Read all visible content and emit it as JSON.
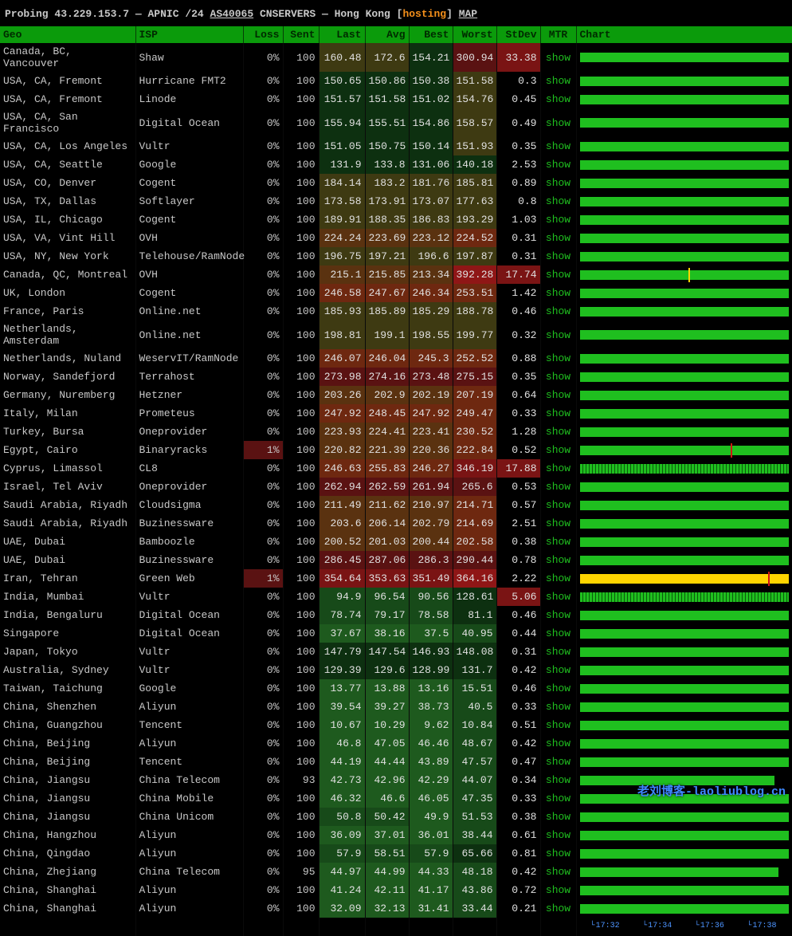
{
  "header": {
    "probing_label": "Probing",
    "ip": "43.229.153.7",
    "dash": "—",
    "registry": "APNIC",
    "cidr": "/24",
    "asn": "AS40065",
    "asn_name": "CNSERVERS",
    "location": "Hong Kong",
    "tag": "hosting",
    "map_label": "MAP"
  },
  "columns": {
    "geo": "Geo",
    "isp": "ISP",
    "loss": "Loss",
    "sent": "Sent",
    "last": "Last",
    "avg": "Avg",
    "best": "Best",
    "worst": "Worst",
    "stdev": "StDev",
    "mtr": "MTR",
    "chart": "Chart"
  },
  "mtr_label": "show",
  "chart_axis": [
    "17:32",
    "17:34",
    "17:36",
    "17:38"
  ],
  "watermark": "老刘博客-laoliublog.cn",
  "rows": [
    {
      "geo": "Canada, BC, Vancouver",
      "isp": "Shaw",
      "loss": "0%",
      "sent": "100",
      "last": "160.48",
      "avg": "172.6",
      "best": "154.21",
      "worst": "300.94",
      "stdev": "33.38",
      "chart": {
        "color": "#1fbf1f",
        "fill": 100
      }
    },
    {
      "geo": "USA, CA, Fremont",
      "isp": "Hurricane FMT2",
      "loss": "0%",
      "sent": "100",
      "last": "150.65",
      "avg": "150.86",
      "best": "150.38",
      "worst": "151.58",
      "stdev": "0.3",
      "chart": {
        "color": "#1fbf1f",
        "fill": 100
      }
    },
    {
      "geo": "USA, CA, Fremont",
      "isp": "Linode",
      "loss": "0%",
      "sent": "100",
      "last": "151.57",
      "avg": "151.58",
      "best": "151.02",
      "worst": "154.76",
      "stdev": "0.45",
      "chart": {
        "color": "#1fbf1f",
        "fill": 100
      }
    },
    {
      "geo": "USA, CA, San Francisco",
      "isp": "Digital Ocean",
      "loss": "0%",
      "sent": "100",
      "last": "155.94",
      "avg": "155.51",
      "best": "154.86",
      "worst": "158.57",
      "stdev": "0.49",
      "chart": {
        "color": "#1fbf1f",
        "fill": 100
      }
    },
    {
      "geo": "USA, CA, Los Angeles",
      "isp": "Vultr",
      "loss": "0%",
      "sent": "100",
      "last": "151.05",
      "avg": "150.75",
      "best": "150.14",
      "worst": "151.93",
      "stdev": "0.35",
      "chart": {
        "color": "#1fbf1f",
        "fill": 100
      }
    },
    {
      "geo": "USA, CA, Seattle",
      "isp": "Google",
      "loss": "0%",
      "sent": "100",
      "last": "131.9",
      "avg": "133.8",
      "best": "131.06",
      "worst": "140.18",
      "stdev": "2.53",
      "chart": {
        "color": "#1fbf1f",
        "fill": 100
      }
    },
    {
      "geo": "USA, CO, Denver",
      "isp": "Cogent",
      "loss": "0%",
      "sent": "100",
      "last": "184.14",
      "avg": "183.2",
      "best": "181.76",
      "worst": "185.81",
      "stdev": "0.89",
      "chart": {
        "color": "#1fbf1f",
        "fill": 100
      }
    },
    {
      "geo": "USA, TX, Dallas",
      "isp": "Softlayer",
      "loss": "0%",
      "sent": "100",
      "last": "173.58",
      "avg": "173.91",
      "best": "173.07",
      "worst": "177.63",
      "stdev": "0.8",
      "chart": {
        "color": "#1fbf1f",
        "fill": 100
      }
    },
    {
      "geo": "USA, IL, Chicago",
      "isp": "Cogent",
      "loss": "0%",
      "sent": "100",
      "last": "189.91",
      "avg": "188.35",
      "best": "186.83",
      "worst": "193.29",
      "stdev": "1.03",
      "chart": {
        "color": "#1fbf1f",
        "fill": 100
      }
    },
    {
      "geo": "USA, VA, Vint Hill",
      "isp": "OVH",
      "loss": "0%",
      "sent": "100",
      "last": "224.24",
      "avg": "223.69",
      "best": "223.12",
      "worst": "224.52",
      "stdev": "0.31",
      "chart": {
        "color": "#1fbf1f",
        "fill": 100
      }
    },
    {
      "geo": "USA, NY, New York",
      "isp": "Telehouse/RamNode",
      "loss": "0%",
      "sent": "100",
      "last": "196.75",
      "avg": "197.21",
      "best": "196.6",
      "worst": "197.87",
      "stdev": "0.31",
      "chart": {
        "color": "#1fbf1f",
        "fill": 100
      }
    },
    {
      "geo": "Canada, QC, Montreal",
      "isp": "OVH",
      "loss": "0%",
      "sent": "100",
      "last": "215.1",
      "avg": "215.85",
      "best": "213.34",
      "worst": "392.28",
      "stdev": "17.74",
      "chart": {
        "color": "#1fbf1f",
        "fill": 100,
        "spike": {
          "pos": 52,
          "color": "#ffd400"
        }
      }
    },
    {
      "geo": "UK, London",
      "isp": "Cogent",
      "loss": "0%",
      "sent": "100",
      "last": "246.58",
      "avg": "247.67",
      "best": "246.34",
      "worst": "253.51",
      "stdev": "1.42",
      "chart": {
        "color": "#1fbf1f",
        "fill": 100
      }
    },
    {
      "geo": "France, Paris",
      "isp": "Online.net",
      "loss": "0%",
      "sent": "100",
      "last": "185.93",
      "avg": "185.89",
      "best": "185.29",
      "worst": "188.78",
      "stdev": "0.46",
      "chart": {
        "color": "#1fbf1f",
        "fill": 100
      }
    },
    {
      "geo": "Netherlands, Amsterdam",
      "isp": "Online.net",
      "loss": "0%",
      "sent": "100",
      "last": "198.81",
      "avg": "199.1",
      "best": "198.55",
      "worst": "199.77",
      "stdev": "0.32",
      "chart": {
        "color": "#1fbf1f",
        "fill": 100
      }
    },
    {
      "geo": "Netherlands, Nuland",
      "isp": "WeservIT/RamNode",
      "loss": "0%",
      "sent": "100",
      "last": "246.07",
      "avg": "246.04",
      "best": "245.3",
      "worst": "252.52",
      "stdev": "0.88",
      "chart": {
        "color": "#1fbf1f",
        "fill": 100
      }
    },
    {
      "geo": "Norway, Sandefjord",
      "isp": "Terrahost",
      "loss": "0%",
      "sent": "100",
      "last": "273.98",
      "avg": "274.16",
      "best": "273.48",
      "worst": "275.15",
      "stdev": "0.35",
      "chart": {
        "color": "#1fbf1f",
        "fill": 100
      }
    },
    {
      "geo": "Germany, Nuremberg",
      "isp": "Hetzner",
      "loss": "0%",
      "sent": "100",
      "last": "203.26",
      "avg": "202.9",
      "best": "202.19",
      "worst": "207.19",
      "stdev": "0.64",
      "chart": {
        "color": "#1fbf1f",
        "fill": 100
      }
    },
    {
      "geo": "Italy, Milan",
      "isp": "Prometeus",
      "loss": "0%",
      "sent": "100",
      "last": "247.92",
      "avg": "248.45",
      "best": "247.92",
      "worst": "249.47",
      "stdev": "0.33",
      "chart": {
        "color": "#1fbf1f",
        "fill": 100
      }
    },
    {
      "geo": "Turkey, Bursa",
      "isp": "Oneprovider",
      "loss": "0%",
      "sent": "100",
      "last": "223.93",
      "avg": "224.41",
      "best": "223.41",
      "worst": "230.52",
      "stdev": "1.28",
      "chart": {
        "color": "#1fbf1f",
        "fill": 100
      }
    },
    {
      "geo": "Egypt, Cairo",
      "isp": "Binaryracks",
      "loss": "1%",
      "sent": "100",
      "last": "220.82",
      "avg": "221.39",
      "best": "220.36",
      "worst": "222.84",
      "stdev": "0.52",
      "chart": {
        "color": "#1fbf1f",
        "fill": 100,
        "spike": {
          "pos": 72,
          "color": "#d01414"
        }
      }
    },
    {
      "geo": "Cyprus, Limassol",
      "isp": "CL8",
      "loss": "0%",
      "sent": "100",
      "last": "246.63",
      "avg": "255.83",
      "best": "246.27",
      "worst": "346.19",
      "stdev": "17.88",
      "chart": {
        "color": "#1fbf1f",
        "fill": 100,
        "noisy": true
      }
    },
    {
      "geo": "Israel, Tel Aviv",
      "isp": "Oneprovider",
      "loss": "0%",
      "sent": "100",
      "last": "262.94",
      "avg": "262.59",
      "best": "261.94",
      "worst": "265.6",
      "stdev": "0.53",
      "chart": {
        "color": "#1fbf1f",
        "fill": 100
      }
    },
    {
      "geo": "Saudi Arabia, Riyadh",
      "isp": "Cloudsigma",
      "loss": "0%",
      "sent": "100",
      "last": "211.49",
      "avg": "211.62",
      "best": "210.97",
      "worst": "214.71",
      "stdev": "0.57",
      "chart": {
        "color": "#1fbf1f",
        "fill": 100
      }
    },
    {
      "geo": "Saudi Arabia, Riyadh",
      "isp": "Buzinessware",
      "loss": "0%",
      "sent": "100",
      "last": "203.6",
      "avg": "206.14",
      "best": "202.79",
      "worst": "214.69",
      "stdev": "2.51",
      "chart": {
        "color": "#1fbf1f",
        "fill": 100
      }
    },
    {
      "geo": "UAE, Dubai",
      "isp": "Bamboozle",
      "loss": "0%",
      "sent": "100",
      "last": "200.52",
      "avg": "201.03",
      "best": "200.44",
      "worst": "202.58",
      "stdev": "0.38",
      "chart": {
        "color": "#1fbf1f",
        "fill": 100
      }
    },
    {
      "geo": "UAE, Dubai",
      "isp": "Buzinessware",
      "loss": "0%",
      "sent": "100",
      "last": "286.45",
      "avg": "287.06",
      "best": "286.3",
      "worst": "290.44",
      "stdev": "0.78",
      "chart": {
        "color": "#1fbf1f",
        "fill": 100
      }
    },
    {
      "geo": "Iran, Tehran",
      "isp": "Green Web",
      "loss": "1%",
      "sent": "100",
      "last": "354.64",
      "avg": "353.63",
      "best": "351.49",
      "worst": "364.16",
      "stdev": "2.22",
      "chart": {
        "color": "#ffd400",
        "fill": 100,
        "spike": {
          "pos": 90,
          "color": "#d01414"
        }
      }
    },
    {
      "geo": "India, Mumbai",
      "isp": "Vultr",
      "loss": "0%",
      "sent": "100",
      "last": "94.9",
      "avg": "96.54",
      "best": "90.56",
      "worst": "128.61",
      "stdev": "5.06",
      "chart": {
        "color": "#1fbf1f",
        "fill": 100,
        "noisy": true
      }
    },
    {
      "geo": "India, Bengaluru",
      "isp": "Digital Ocean",
      "loss": "0%",
      "sent": "100",
      "last": "78.74",
      "avg": "79.17",
      "best": "78.58",
      "worst": "81.1",
      "stdev": "0.46",
      "chart": {
        "color": "#1fbf1f",
        "fill": 100
      }
    },
    {
      "geo": "Singapore",
      "isp": "Digital Ocean",
      "loss": "0%",
      "sent": "100",
      "last": "37.67",
      "avg": "38.16",
      "best": "37.5",
      "worst": "40.95",
      "stdev": "0.44",
      "chart": {
        "color": "#1fbf1f",
        "fill": 100
      }
    },
    {
      "geo": "Japan, Tokyo",
      "isp": "Vultr",
      "loss": "0%",
      "sent": "100",
      "last": "147.79",
      "avg": "147.54",
      "best": "146.93",
      "worst": "148.08",
      "stdev": "0.31",
      "chart": {
        "color": "#1fbf1f",
        "fill": 100
      }
    },
    {
      "geo": "Australia, Sydney",
      "isp": "Vultr",
      "loss": "0%",
      "sent": "100",
      "last": "129.39",
      "avg": "129.6",
      "best": "128.99",
      "worst": "131.7",
      "stdev": "0.42",
      "chart": {
        "color": "#1fbf1f",
        "fill": 100
      }
    },
    {
      "geo": "Taiwan, Taichung",
      "isp": "Google",
      "loss": "0%",
      "sent": "100",
      "last": "13.77",
      "avg": "13.88",
      "best": "13.16",
      "worst": "15.51",
      "stdev": "0.46",
      "chart": {
        "color": "#1fbf1f",
        "fill": 100
      }
    },
    {
      "geo": "China, Shenzhen",
      "isp": "Aliyun",
      "loss": "0%",
      "sent": "100",
      "last": "39.54",
      "avg": "39.27",
      "best": "38.73",
      "worst": "40.5",
      "stdev": "0.33",
      "chart": {
        "color": "#1fbf1f",
        "fill": 100
      }
    },
    {
      "geo": "China, Guangzhou",
      "isp": "Tencent",
      "loss": "0%",
      "sent": "100",
      "last": "10.67",
      "avg": "10.29",
      "best": "9.62",
      "worst": "10.84",
      "stdev": "0.51",
      "chart": {
        "color": "#1fbf1f",
        "fill": 100
      }
    },
    {
      "geo": "China, Beijing",
      "isp": "Aliyun",
      "loss": "0%",
      "sent": "100",
      "last": "46.8",
      "avg": "47.05",
      "best": "46.46",
      "worst": "48.67",
      "stdev": "0.42",
      "chart": {
        "color": "#1fbf1f",
        "fill": 100
      }
    },
    {
      "geo": "China, Beijing",
      "isp": "Tencent",
      "loss": "0%",
      "sent": "100",
      "last": "44.19",
      "avg": "44.44",
      "best": "43.89",
      "worst": "47.57",
      "stdev": "0.47",
      "chart": {
        "color": "#1fbf1f",
        "fill": 100
      }
    },
    {
      "geo": "China, Jiangsu",
      "isp": "China Telecom",
      "loss": "0%",
      "sent": "93",
      "last": "42.73",
      "avg": "42.96",
      "best": "42.29",
      "worst": "44.07",
      "stdev": "0.34",
      "chart": {
        "color": "#1fbf1f",
        "fill": 93
      }
    },
    {
      "geo": "China, Jiangsu",
      "isp": "China Mobile",
      "loss": "0%",
      "sent": "100",
      "last": "46.32",
      "avg": "46.6",
      "best": "46.05",
      "worst": "47.35",
      "stdev": "0.33",
      "chart": {
        "color": "#1fbf1f",
        "fill": 100
      }
    },
    {
      "geo": "China, Jiangsu",
      "isp": "China Unicom",
      "loss": "0%",
      "sent": "100",
      "last": "50.8",
      "avg": "50.42",
      "best": "49.9",
      "worst": "51.53",
      "stdev": "0.38",
      "chart": {
        "color": "#1fbf1f",
        "fill": 100
      }
    },
    {
      "geo": "China, Hangzhou",
      "isp": "Aliyun",
      "loss": "0%",
      "sent": "100",
      "last": "36.09",
      "avg": "37.01",
      "best": "36.01",
      "worst": "38.44",
      "stdev": "0.61",
      "chart": {
        "color": "#1fbf1f",
        "fill": 100
      }
    },
    {
      "geo": "China, Qingdao",
      "isp": "Aliyun",
      "loss": "0%",
      "sent": "100",
      "last": "57.9",
      "avg": "58.51",
      "best": "57.9",
      "worst": "65.66",
      "stdev": "0.81",
      "chart": {
        "color": "#1fbf1f",
        "fill": 100
      }
    },
    {
      "geo": "China, Zhejiang",
      "isp": "China Telecom",
      "loss": "0%",
      "sent": "95",
      "last": "44.97",
      "avg": "44.99",
      "best": "44.33",
      "worst": "48.18",
      "stdev": "0.42",
      "chart": {
        "color": "#1fbf1f",
        "fill": 95
      }
    },
    {
      "geo": "China, Shanghai",
      "isp": "Aliyun",
      "loss": "0%",
      "sent": "100",
      "last": "41.24",
      "avg": "42.11",
      "best": "41.17",
      "worst": "43.86",
      "stdev": "0.72",
      "chart": {
        "color": "#1fbf1f",
        "fill": 100
      }
    },
    {
      "geo": "China, Shanghai",
      "isp": "Aliyun",
      "loss": "0%",
      "sent": "100",
      "last": "32.09",
      "avg": "32.13",
      "best": "31.41",
      "worst": "33.44",
      "stdev": "0.21",
      "chart": {
        "color": "#1fbf1f",
        "fill": 100
      }
    }
  ],
  "heat_palette": {
    "g0": "#0d3010",
    "g1": "#174a19",
    "g2": "#1e5a1e",
    "y0": "#3e3a12",
    "y1": "#5a4e12",
    "o0": "#5a3210",
    "o1": "#6e2810",
    "r0": "#5a1212",
    "r1": "#7a1414",
    "r2": "#8f1616"
  }
}
